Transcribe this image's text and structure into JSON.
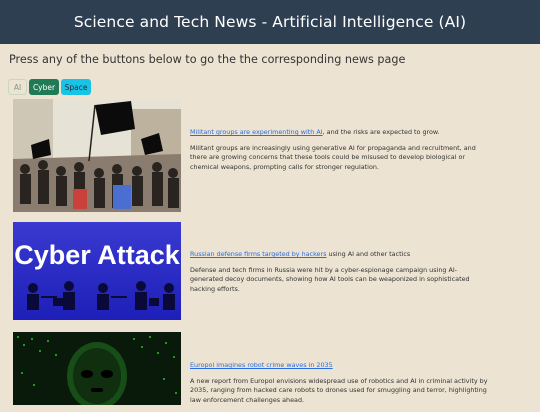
{
  "header": {
    "title": "Science and Tech News - Artificial Intelligence (AI)"
  },
  "intro": {
    "text": "Press any of the buttons below to go the the corresponding news page"
  },
  "tabs": [
    {
      "label": "AI"
    },
    {
      "label": "Cyber"
    },
    {
      "label": "Space"
    }
  ],
  "articles": [
    {
      "headline_link": "Militant groups are experimenting with AI",
      "headline_rest": ", and the risks are expected to grow.",
      "summary": "Militant groups are increasingly using generative AI for propaganda and recruitment, and there are growing concerns that these tools could be misused to develop biological or chemical weapons, prompting calls for stronger regulation."
    },
    {
      "headline_link": "Russian defense firms targeted by hackers",
      "headline_rest": " using AI and other tactics",
      "summary": "Defense and tech firms in Russia were hit by a cyber-espionage campaign using AI-generated decoy documents, showing how AI tools can be weaponized in sophisticated hacking efforts.",
      "image_text": "Cyber Attack"
    },
    {
      "headline_link": "Europol imagines robot crime waves in 2035",
      "headline_rest": "",
      "summary": "A new report from Europol envisions widespread use of robotics and AI in criminal activity by 2035, ranging from hacked care robots to drones used for smuggling and terror, highlighting law enforcement challenges ahead."
    }
  ]
}
